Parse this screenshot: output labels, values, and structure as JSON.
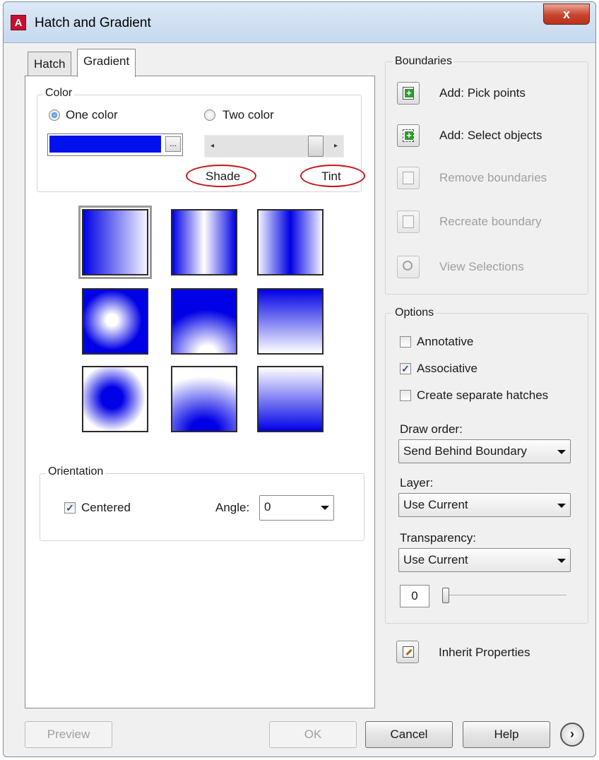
{
  "window": {
    "title": "Hatch and Gradient",
    "close_label": "x",
    "icon_letter": "A"
  },
  "tabs": [
    {
      "label": "Hatch"
    },
    {
      "label": "Gradient"
    }
  ],
  "color": {
    "group_label": "Color",
    "one_color": "One color",
    "two_color": "Two color",
    "one_color_selected": true,
    "swatch_color": "#0010ee",
    "browse_label": "...",
    "shade_label": "Shade",
    "tint_label": "Tint",
    "shade_tint_value": 0.9
  },
  "gradient_patterns": [
    {
      "id": "linear-h",
      "selected": true
    },
    {
      "id": "cylinder-h",
      "selected": false
    },
    {
      "id": "inv-cylinder-h",
      "selected": false
    },
    {
      "id": "spherical",
      "selected": false
    },
    {
      "id": "hemispherical",
      "selected": false
    },
    {
      "id": "curved",
      "selected": false
    },
    {
      "id": "inv-spherical",
      "selected": false
    },
    {
      "id": "inv-hemispherical",
      "selected": false
    },
    {
      "id": "inv-curved",
      "selected": false
    }
  ],
  "orientation": {
    "group_label": "Orientation",
    "centered_label": "Centered",
    "centered": true,
    "angle_label": "Angle:",
    "angle_value": "0"
  },
  "boundaries": {
    "group_label": "Boundaries",
    "items": [
      {
        "label": "Add: Pick points",
        "enabled": true
      },
      {
        "label": "Add: Select objects",
        "enabled": true
      },
      {
        "label": "Remove boundaries",
        "enabled": false
      },
      {
        "label": "Recreate boundary",
        "enabled": false
      },
      {
        "label": "View Selections",
        "enabled": false
      }
    ]
  },
  "options": {
    "group_label": "Options",
    "annotative": "Annotative",
    "annotative_checked": false,
    "associative": "Associative",
    "associative_checked": true,
    "separate": "Create separate hatches",
    "separate_checked": false,
    "draw_order_label": "Draw order:",
    "draw_order_value": "Send Behind Boundary",
    "layer_label": "Layer:",
    "layer_value": "Use Current",
    "transparency_label": "Transparency:",
    "transparency_value": "Use Current",
    "transparency_amount": "0"
  },
  "inherit_label": "Inherit Properties",
  "buttons": {
    "preview": "Preview",
    "ok": "OK",
    "cancel": "Cancel",
    "help": "Help",
    "more": "›"
  },
  "check_mark": "✓"
}
